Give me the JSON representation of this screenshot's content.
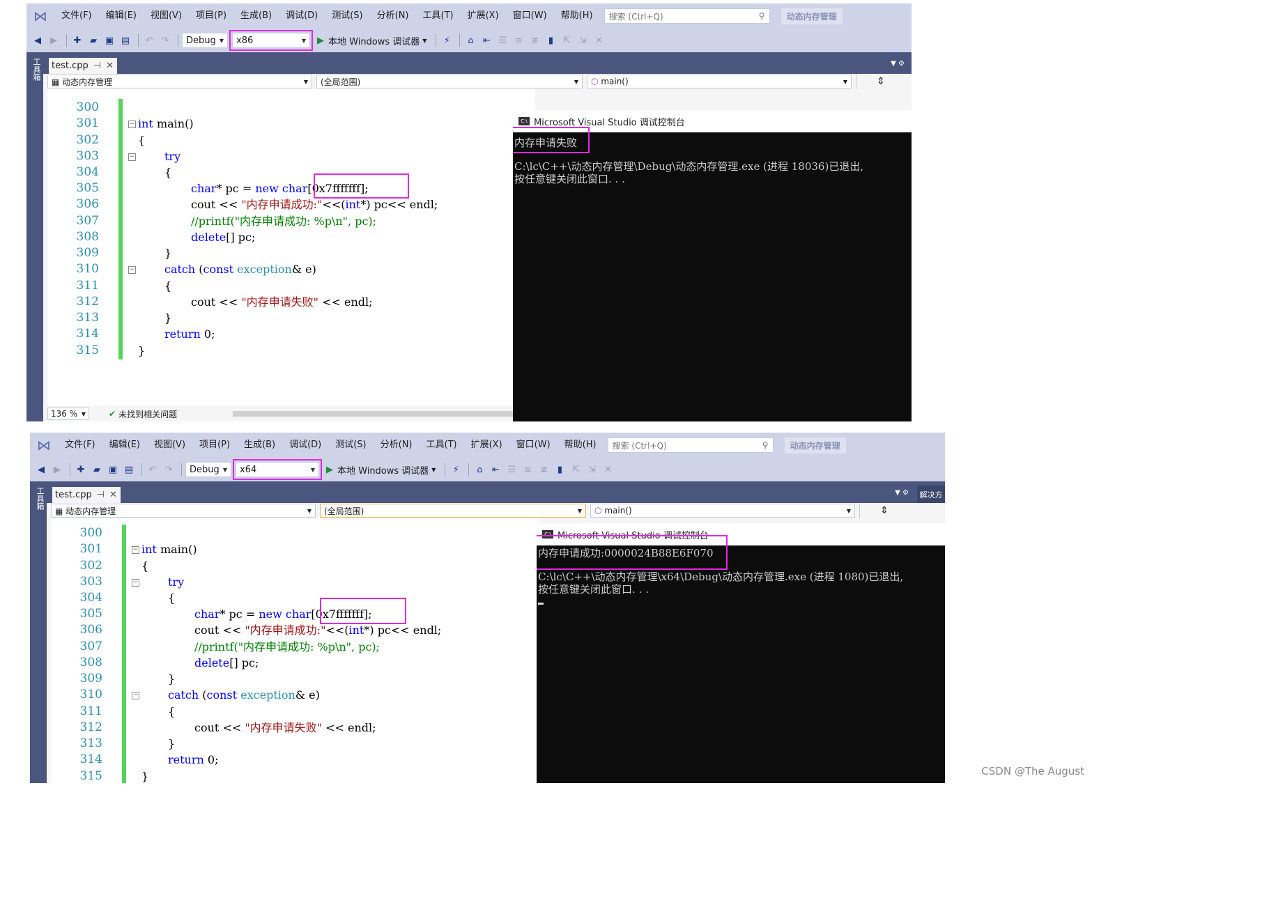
{
  "menu": [
    "文件(F)",
    "编辑(E)",
    "视图(V)",
    "项目(P)",
    "生成(B)",
    "调试(D)",
    "测试(S)",
    "分析(N)",
    "工具(T)",
    "扩展(X)",
    "窗口(W)",
    "帮助(H)"
  ],
  "search_placeholder": "搜索 (Ctrl+Q)",
  "project_name": "动态内存管理",
  "toolbox_label": "工具箱",
  "solution_label": "解决方",
  "toolbar": {
    "config": "Debug",
    "run_label": "本地 Windows 调试器"
  },
  "tab": {
    "name": "test.cpp"
  },
  "nav": {
    "scope": "(全局范围)",
    "func": "main()"
  },
  "status": {
    "zoom": "136 %",
    "issues": "未找到相关问题"
  },
  "console_title": "Microsoft Visual Studio 调试控制台",
  "code": {
    "line_numbers": [
      "300",
      "301",
      "302",
      "303",
      "304",
      "305",
      "306",
      "307",
      "308",
      "309",
      "310",
      "311",
      "312",
      "313",
      "314",
      "315"
    ],
    "l301_kw": "int",
    "l301_rest": " main()",
    "l302": "{",
    "l303": "try",
    "l304": "{",
    "l305_t": "char",
    "l305_a": "* pc = ",
    "l305_kw": "new",
    "l305_t2": " char",
    "l305_b": "[0x7fffffff];",
    "l306_a": "cout << ",
    "l306_s": "\"内存申请成功:\"",
    "l306_b": "<<(",
    "l306_k": "int",
    "l306_c": "*) pc<< endl;",
    "l307": "//printf(\"内存申请成功: %p\\n\", pc);",
    "l308_kw": "delete",
    "l308_rest": "[] pc;",
    "l309": "}",
    "l310_kw": "catch",
    "l310_a": " (",
    "l310_k2": "const",
    "l310_t": " exception",
    "l310_b": "& e)",
    "l311": "{",
    "l312_a": "cout << ",
    "l312_s": "\"内存申请失败\"",
    "l312_b": " << endl;",
    "l313": "}",
    "l314_kw": "return",
    "l314_rest": " 0;",
    "l315": "}"
  },
  "panels": [
    {
      "platform": "x86",
      "console_output": "内存申请失败",
      "console_exit": "C:\\lc\\C++\\动态内存管理\\Debug\\动态内存管理.exe (进程 18036)已退出,",
      "console_prompt": "按任意键关闭此窗口. . ."
    },
    {
      "platform": "x64",
      "console_output": "内存申请成功:0000024B88E6F070",
      "console_exit": "C:\\lc\\C++\\动态内存管理\\x64\\Debug\\动态内存管理.exe (进程 1080)已退出,",
      "console_prompt": "按任意键关闭此窗口. . ."
    }
  ],
  "watermark": "CSDN @The   August"
}
